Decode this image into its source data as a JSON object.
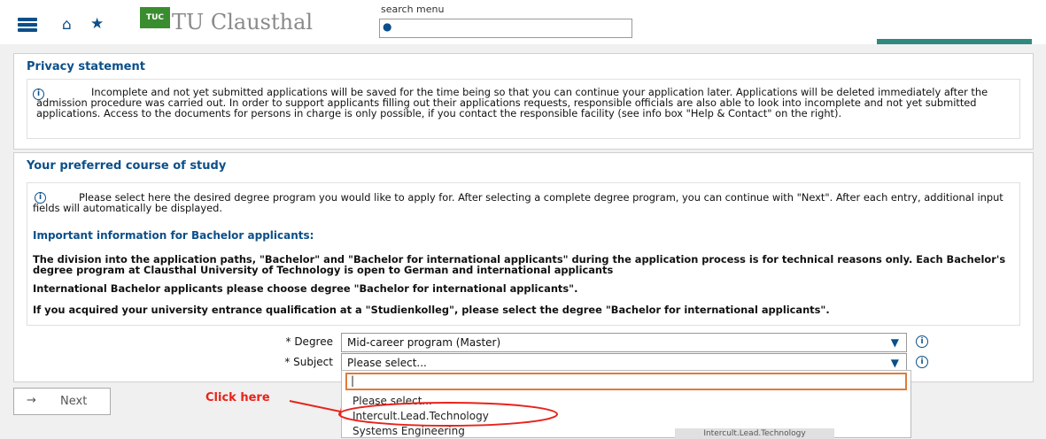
{
  "header": {
    "logo_text": "TU Clausthal",
    "logo_badge": "TUC",
    "search_label": "search menu",
    "search_placeholder": ""
  },
  "privacy": {
    "title": "Privacy statement",
    "text": "Incomplete and not yet submitted applications will be saved for the time being so that you can continue your application later. Applications will be deleted immediately after the admission procedure was carried out. In order to support applicants filling out their applications requests, responsible officials are also able to look into incomplete and not yet submitted applications. Access to the documents for persons in charge is only possible, if you contact the responsible facility (see info box \"Help & Contact\" on the right)."
  },
  "course": {
    "title": "Your preferred course of study",
    "intro": "Please select here the desired degree program you would like to apply for. After selecting a complete degree program, you can continue with \"Next\". After each entry, additional input fields will automatically be displayed.",
    "important_heading": "Important information for Bachelor applicants:",
    "para1": "The division into the application paths, \"Bachelor\" and \"Bachelor for international applicants\" during the application process is for technical reasons only. Each Bachelor's degree program at Clausthal University of Technology is open to German and international applicants",
    "para2": "International Bachelor applicants please choose degree \"Bachelor for international applicants\".",
    "para3": "If you acquired your university entrance qualification at a \"Studienkolleg\", please select the degree \"Bachelor for international applicants\"."
  },
  "form": {
    "degree_label": "* Degree",
    "degree_value": "Mid-career program (Master)",
    "subject_label": "* Subject",
    "subject_value": "Please select..."
  },
  "dropdown": {
    "search_value": "|",
    "items": [
      "Please select...",
      "Intercult.Lead.Technology",
      "Systems Engineering"
    ]
  },
  "tooltip": "Intercult.Lead.Technology",
  "next_label": "Next",
  "annotation": "Click here",
  "colors": {
    "brand": "#0b4f8a",
    "accent": "#e8231a",
    "highlight": "#e07a3a",
    "logo": "#3a8d2e"
  }
}
